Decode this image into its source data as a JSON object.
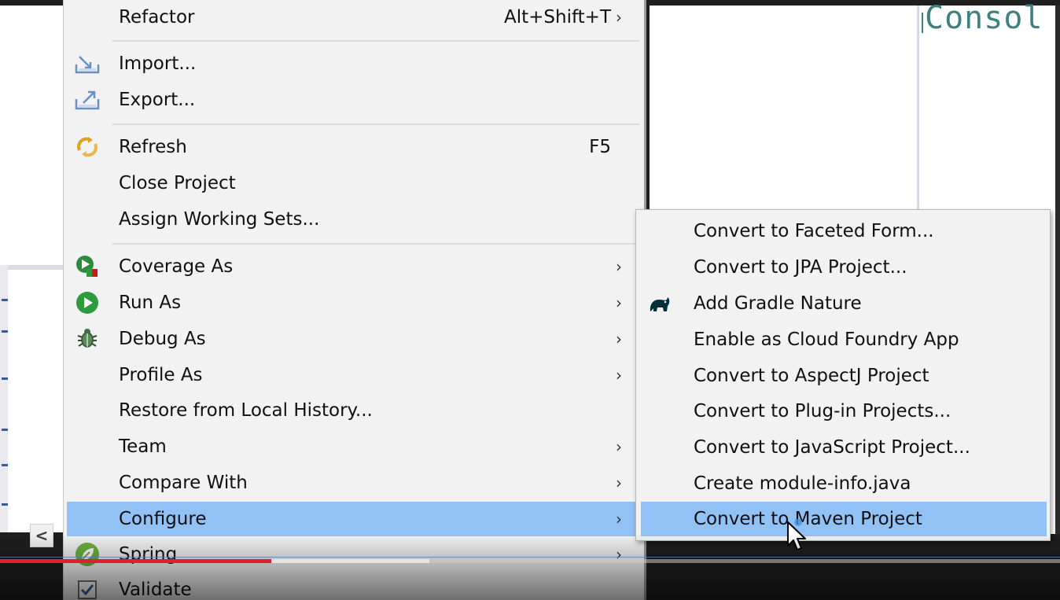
{
  "background": {
    "console_text": "Consol"
  },
  "menu": {
    "items": [
      {
        "label": "Refactor",
        "accelerator": "Alt+Shift+T",
        "arrow": "›"
      },
      {
        "label": "Import...",
        "icon": "import-icon"
      },
      {
        "label": "Export...",
        "icon": "export-icon"
      },
      {
        "label": "Refresh",
        "accelerator": "F5",
        "icon": "refresh-icon"
      },
      {
        "label": "Close Project"
      },
      {
        "label": "Assign Working Sets..."
      },
      {
        "label": "Coverage As",
        "arrow": "›",
        "icon": "coverage-icon"
      },
      {
        "label": "Run As",
        "arrow": "›",
        "icon": "run-icon"
      },
      {
        "label": "Debug As",
        "arrow": "›",
        "icon": "debug-bug-icon"
      },
      {
        "label": "Profile As",
        "arrow": "›"
      },
      {
        "label": "Restore from Local History..."
      },
      {
        "label": "Team",
        "arrow": "›"
      },
      {
        "label": "Compare With",
        "arrow": "›"
      },
      {
        "label": "Configure",
        "arrow": "›",
        "selected": true
      },
      {
        "label": "Spring",
        "arrow": "›",
        "icon": "spring-leaf-icon"
      },
      {
        "label": "Validate",
        "icon": "checkbox-icon"
      }
    ]
  },
  "submenu": {
    "items": [
      {
        "label": "Convert to Faceted Form..."
      },
      {
        "label": "Convert to JPA Project..."
      },
      {
        "label": "Add Gradle Nature",
        "icon": "gradle-elephant-icon"
      },
      {
        "label": "Enable as Cloud Foundry App"
      },
      {
        "label": "Convert to AspectJ Project"
      },
      {
        "label": "Convert to Plug-in Projects..."
      },
      {
        "label": "Convert to JavaScript Project..."
      },
      {
        "label": "Create module-info.java"
      },
      {
        "label": "Convert to Maven Project",
        "selected": true
      }
    ]
  },
  "scroll": {
    "left_arrow": "<"
  },
  "video": {
    "progress_fraction": 0.256,
    "buffer_fraction": 0.405
  },
  "colors": {
    "selection": "#91c1f5",
    "menu_bg": "#f2f2f2",
    "console_text": "#3f7f7f",
    "progress": "#e0202c"
  }
}
